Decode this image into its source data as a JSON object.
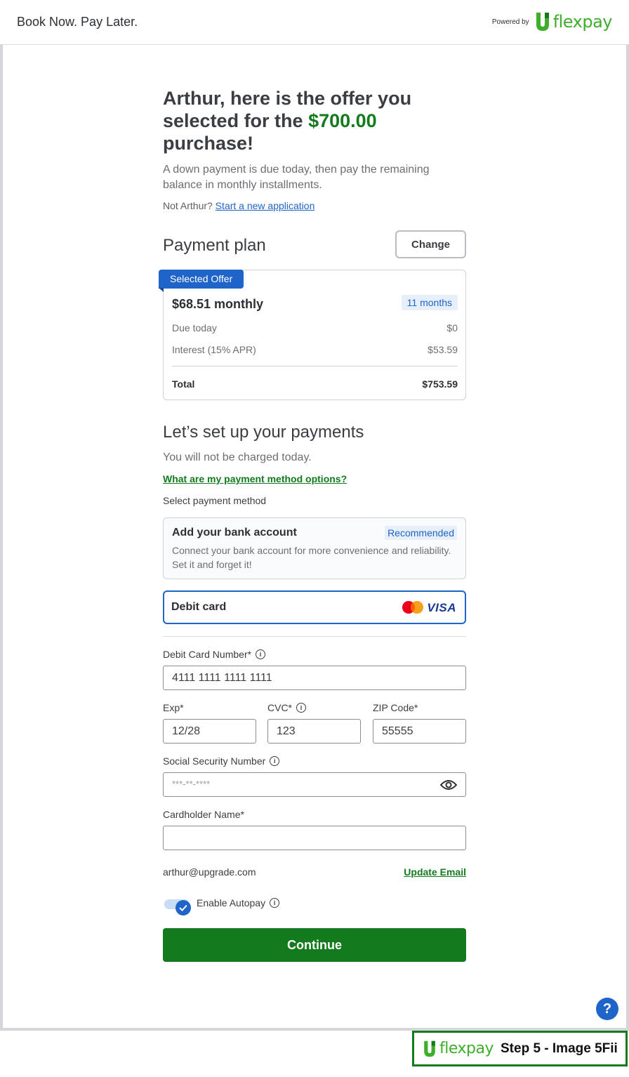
{
  "header": {
    "title": "Book Now. Pay Later.",
    "powered_by": "Powered by",
    "logo_text": "flexpay"
  },
  "intro": {
    "headline_part1": "Arthur, here is the offer you selected for the ",
    "amount": "$700.00",
    "headline_part2": " purchase!",
    "subtext": "A down payment is due today, then pay the remaining balance in monthly installments.",
    "not_user": "Not Arthur?",
    "new_application_link": "Start a new application"
  },
  "plan": {
    "title": "Payment plan",
    "change_label": "Change",
    "tag": "Selected Offer",
    "monthly": "$68.51 monthly",
    "term": "11 months",
    "rows": [
      {
        "label": "Due today",
        "value": "$0"
      },
      {
        "label": "Interest (15% APR)",
        "value": "$53.59"
      }
    ],
    "total_label": "Total",
    "total_value": "$753.59"
  },
  "payments": {
    "title": "Let’s set up your payments",
    "not_charged": "You will not be charged today.",
    "options_link": "What are my payment method options?",
    "select_label": "Select payment method",
    "bank": {
      "title": "Add your bank account",
      "badge": "Recommended",
      "description": "Connect your bank account for more convenience and reliability. Set it and forget it!"
    },
    "debit": {
      "label": "Debit card",
      "visa": "VISA"
    }
  },
  "form": {
    "card_number_label": "Debit Card Number*",
    "card_number_value": "4111 1111 1111 1111",
    "exp_label": "Exp*",
    "exp_value": "12/28",
    "cvc_label": "CVC*",
    "cvc_value": "123",
    "zip_label": "ZIP Code*",
    "zip_value": "55555",
    "ssn_label": "Social Security Number",
    "ssn_placeholder": "***-**-****",
    "name_label": "Cardholder Name*",
    "name_value": "",
    "email": "arthur@upgrade.com",
    "update_email": "Update Email",
    "autopay_label": "Enable Autopay",
    "autopay_enabled": true,
    "continue_label": "Continue"
  },
  "help": {
    "label": "?"
  },
  "step_badge": {
    "logo_text": "flexpay",
    "text": "Step 5 - Image 5Fii"
  },
  "colors": {
    "brand_green": "#137a1e",
    "logo_green": "#3fae2a",
    "accent_blue": "#1f64c8"
  }
}
